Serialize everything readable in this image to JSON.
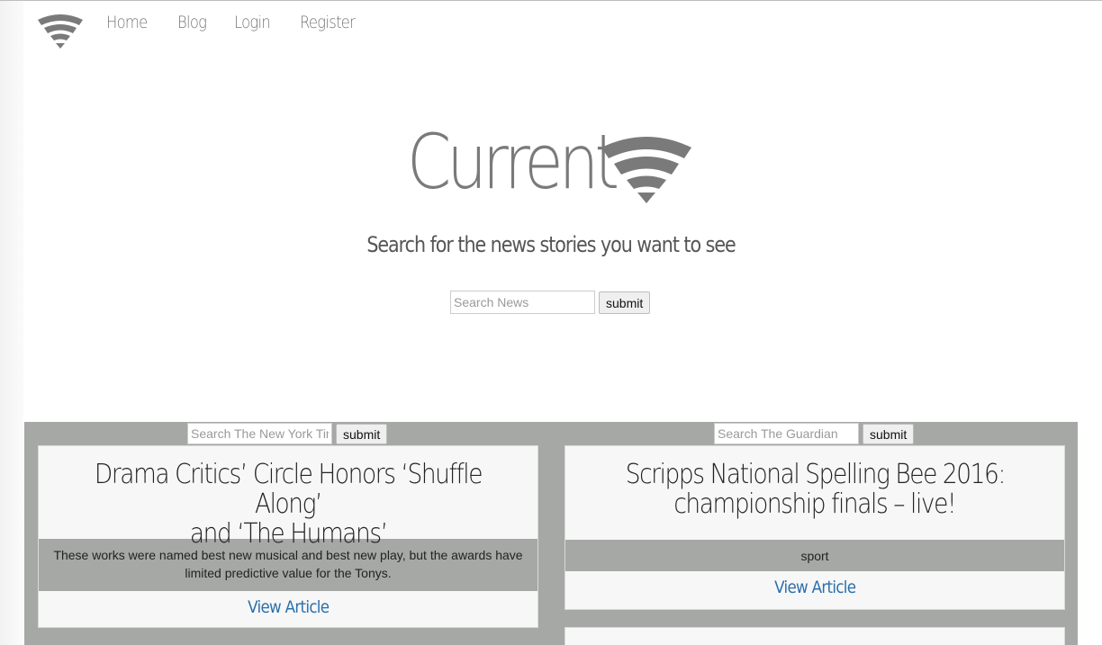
{
  "nav": {
    "logo_icon": "wifi-signal-icon",
    "links": [
      {
        "label": "Home"
      },
      {
        "label": "Blog"
      },
      {
        "label": "Login"
      },
      {
        "label": "Register"
      }
    ]
  },
  "hero": {
    "brand": "Current",
    "brand_icon": "wifi-signal-icon",
    "tagline": "Search for the news stories you want to see",
    "search_placeholder": "Search News",
    "submit_label": "submit"
  },
  "feeds": [
    {
      "search_placeholder": "Search The New York Times",
      "submit_label": "submit",
      "article": {
        "title_line1": "Drama Critics’ Circle Honors ‘Shuffle Along’",
        "title_line2": "and ‘The Humans’",
        "description": "These works were named best new musical and best new play, but the awards have limited predictive value for the Tonys.",
        "link_label": "View Article"
      }
    },
    {
      "search_placeholder": "Search The Guardian",
      "submit_label": "submit",
      "article": {
        "title_line1": "Scripps National Spelling Bee 2016:",
        "title_line2": "championship finals – live!",
        "description": "sport",
        "link_label": "View Article"
      }
    }
  ],
  "colors": {
    "icon_gray": "#7a7a7a",
    "panel_gray": "#a5a8a5",
    "link_blue": "#2a6fad"
  }
}
